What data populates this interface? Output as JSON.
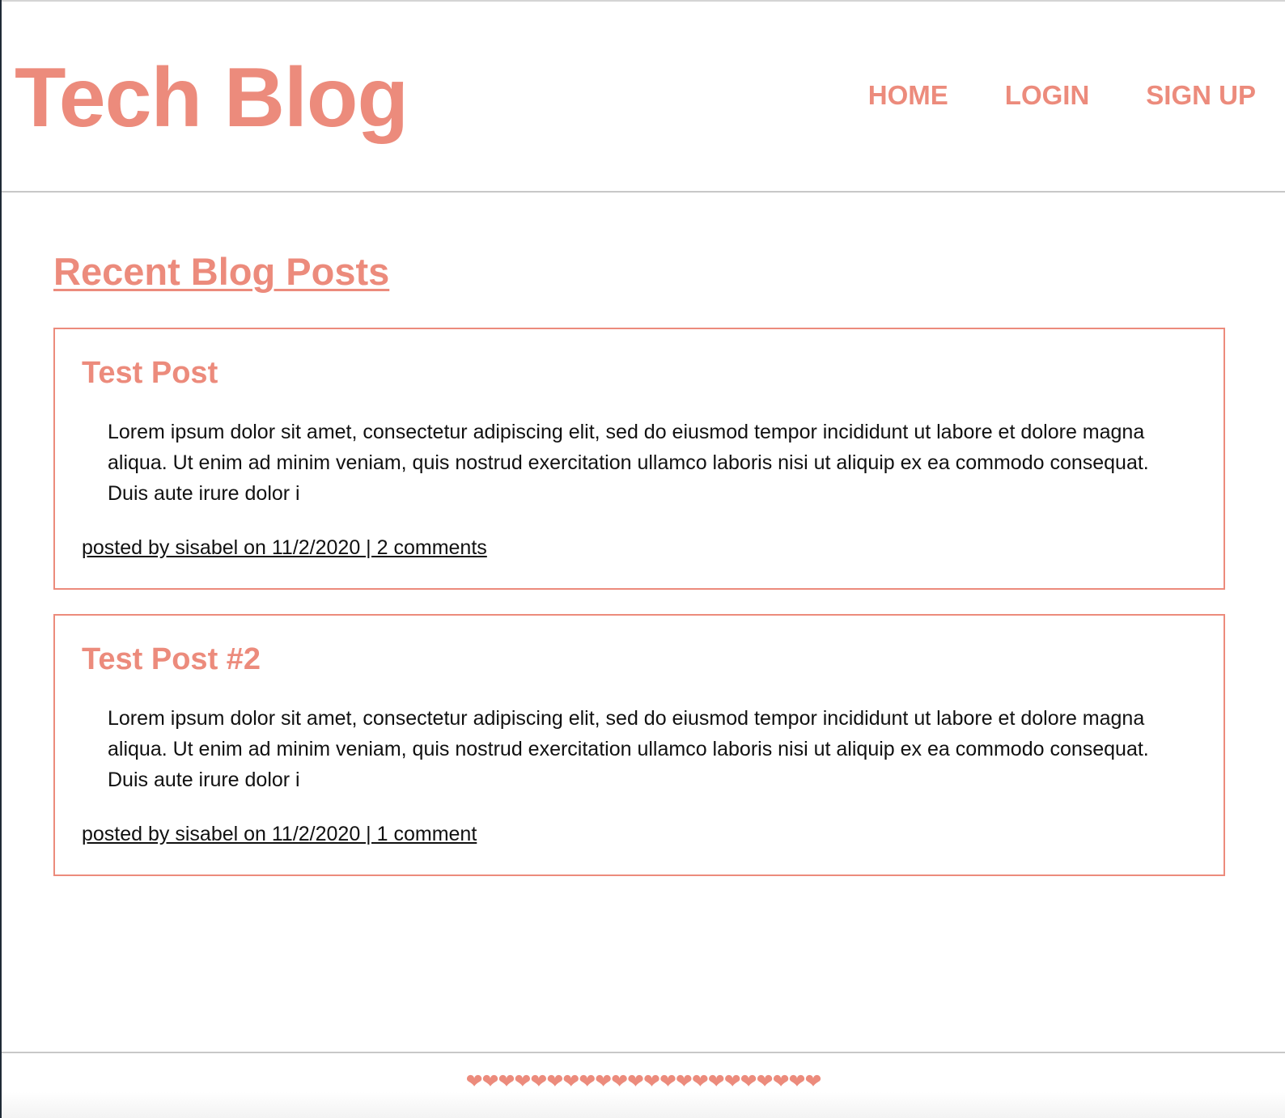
{
  "header": {
    "title": "Tech Blog",
    "nav": [
      {
        "label": "HOME"
      },
      {
        "label": "LOGIN"
      },
      {
        "label": "SIGN UP"
      }
    ]
  },
  "main": {
    "heading": "Recent Blog Posts",
    "posts": [
      {
        "title": "Test Post",
        "body": "Lorem ipsum dolor sit amet, consectetur adipiscing elit, sed do eiusmod tempor incididunt ut labore et dolore magna aliqua. Ut enim ad minim veniam, quis nostrud exercitation ullamco laboris nisi ut aliquip ex ea commodo consequat. Duis aute irure dolor i",
        "meta": "posted by sisabel on 11/2/2020 | 2 comments"
      },
      {
        "title": "Test Post #2",
        "body": "Lorem ipsum dolor sit amet, consectetur adipiscing elit, sed do eiusmod tempor incididunt ut labore et dolore magna aliqua. Ut enim ad minim veniam, quis nostrud exercitation ullamco laboris nisi ut aliquip ex ea commodo consequat. Duis aute irure dolor i",
        "meta": "posted by sisabel on 11/2/2020 | 1 comment"
      }
    ]
  },
  "footer": {
    "hearts": "❤❤❤❤❤❤❤❤❤❤❤❤❤❤❤❤❤❤❤❤❤❤"
  },
  "colors": {
    "accent": "#ec8b7c",
    "text": "#111111",
    "divider": "#c8c8c8"
  }
}
